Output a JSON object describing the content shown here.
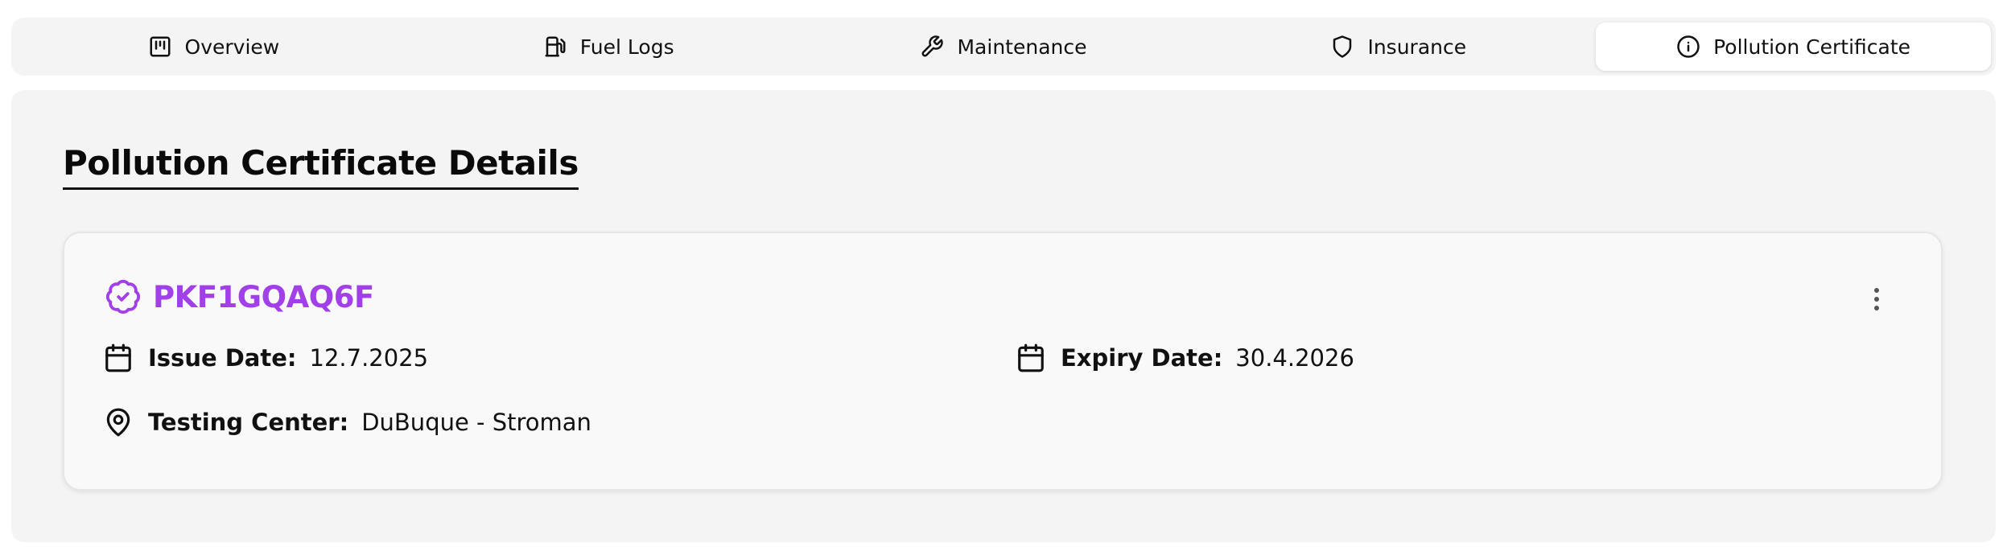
{
  "tabs": [
    {
      "label": "Overview",
      "icon": "clipboard-icon",
      "active": false
    },
    {
      "label": "Fuel Logs",
      "icon": "fuel-pump-icon",
      "active": false
    },
    {
      "label": "Maintenance",
      "icon": "wrench-icon",
      "active": false
    },
    {
      "label": "Insurance",
      "icon": "shield-icon",
      "active": false
    },
    {
      "label": "Pollution Certificate",
      "icon": "info-circle-icon",
      "active": true
    }
  ],
  "section": {
    "title": "Pollution Certificate Details"
  },
  "certificate": {
    "id": "PKF1GQAQ6F",
    "accent_color": "#a140e8",
    "issue_date": {
      "label": "Issue Date:",
      "value": "12.7.2025"
    },
    "expiry_date": {
      "label": "Expiry Date:",
      "value": "30.4.2026"
    },
    "testing_center": {
      "label": "Testing Center:",
      "value": "DuBuque - Stroman"
    }
  }
}
